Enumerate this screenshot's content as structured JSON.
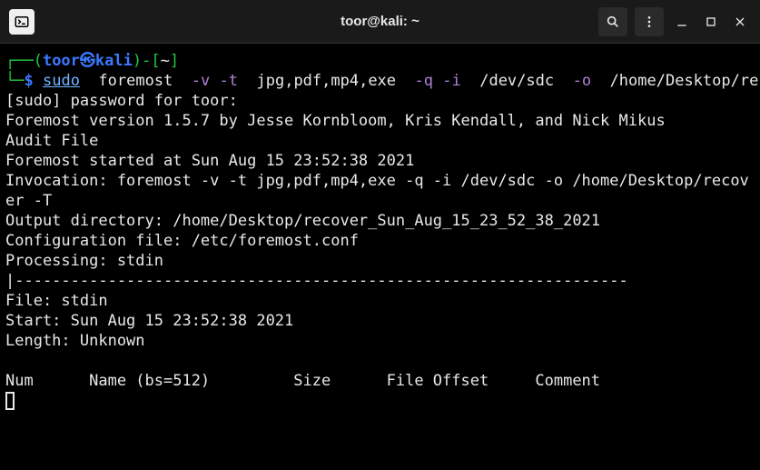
{
  "titlebar": {
    "title": "toor@kali: ~"
  },
  "prompt": {
    "open": "┌──(",
    "user": "toor",
    "at": "㉿",
    "host": "kali",
    "close": ")-[",
    "path": "~",
    "end": "]",
    "line2_prefix": "└─",
    "symbol": "$"
  },
  "command": {
    "sudo": "sudo",
    "program": "foremost",
    "flag_v": "-v",
    "flag_t": "-t",
    "types": "jpg,pdf,mp4,exe",
    "flag_q": "-q",
    "flag_i": "-i",
    "input": "/dev/sdc",
    "flag_o": "-o",
    "output": "/home/Desktop/recover",
    "flag_T": "-T"
  },
  "output": {
    "line01": "[sudo] password for toor:",
    "line02": "Foremost version 1.5.7 by Jesse Kornbloom, Kris Kendall, and Nick Mikus",
    "line03": "Audit File",
    "line04": "",
    "line05": "Foremost started at Sun Aug 15 23:52:38 2021",
    "line06": "Invocation: foremost -v -t jpg,pdf,mp4,exe -q -i /dev/sdc -o /home/Desktop/recover -T",
    "line07": "Output directory: /home/Desktop/recover_Sun_Aug_15_23_52_38_2021",
    "line08": "Configuration file: /etc/foremost.conf",
    "line09": "Processing: stdin",
    "line10": "|------------------------------------------------------------------",
    "line11": "File: stdin",
    "line12": "Start: Sun Aug 15 23:52:38 2021",
    "line13": "Length: Unknown",
    "line14": " ",
    "line15": "Num      Name (bs=512)         Size      File Offset     Comment "
  }
}
